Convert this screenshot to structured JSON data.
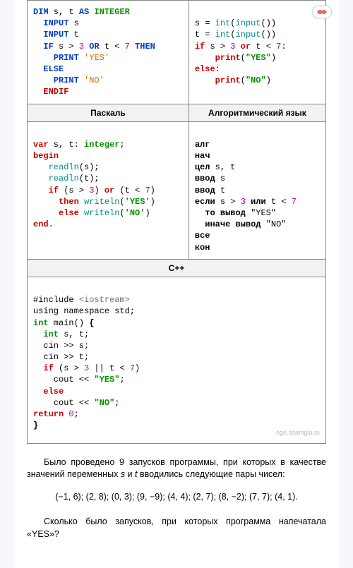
{
  "headers": {
    "pascal": "Паскаль",
    "alg": "Алгоритмический язык",
    "cpp": "С++"
  },
  "code": {
    "basic": {
      "l1a": "DIM",
      "l1b": " s, t ",
      "l1c": "AS",
      "l1d": " INTEGER",
      "l2a": "  INPUT",
      "l2b": " s",
      "l3a": "  INPUT",
      "l3b": " t",
      "l4a": "  IF",
      "l4b": " s > ",
      "l4c": "3",
      "l4d": " OR",
      "l4e": " t < ",
      "l4f": "7",
      "l4g": " THEN",
      "l5a": "    PRINT ",
      "l5b": "'YES'",
      "l6a": "  ELSE",
      "l7a": "    PRINT ",
      "l7b": "'NO'",
      "l8a": "  ENDIF"
    },
    "python": {
      "l1a": "s = ",
      "l1b": "int",
      "l1c": "(",
      "l1d": "input",
      "l1e": "())",
      "l2a": "t = ",
      "l2b": "int",
      "l2c": "(",
      "l2d": "input",
      "l2e": "())",
      "l3a": "if",
      "l3b": " s > ",
      "l3c": "3",
      "l3d": " or",
      "l3e": " t < ",
      "l3f": "7",
      "l3g": ":",
      "l4a": "    print",
      "l4b": "(",
      "l4c": "\"YES\"",
      "l4d": ")",
      "l5a": "else",
      "l5b": ":",
      "l6a": "    print",
      "l6b": "(",
      "l6c": "\"NO\"",
      "l6d": ")"
    },
    "pascal": {
      "l1a": "var",
      "l1b": " s, t: ",
      "l1c": "integer",
      "l1d": ";",
      "l2a": "begin",
      "l3a": "   readln",
      "l3b": "(s);",
      "l4a": "   readln",
      "l4b": "(t);",
      "l5a": "   if",
      "l5b": " (s > ",
      "l5c": "3",
      "l5d": ") ",
      "l5e": "or",
      "l5f": " (t < ",
      "l5g": "7",
      "l5h": ")",
      "l6a": "     then",
      "l6b": " writeln",
      "l6c": "(",
      "l6d": "'YES'",
      "l6e": ")",
      "l7a": "     else",
      "l7b": " writeln",
      "l7c": "(",
      "l7d": "'NO'",
      "l7e": ")",
      "l8a": "end",
      "l8b": "."
    },
    "alg": {
      "l1": "алг",
      "l2": "нач",
      "l3a": "цел",
      "l3b": " s, t",
      "l4a": "ввод",
      "l4b": " s",
      "l5a": "ввод",
      "l5b": " t",
      "l6a": "если",
      "l6b": " s > ",
      "l6c": "3",
      "l6d": " или",
      "l6e": " t < ",
      "l6f": "7",
      "l7a": "  то вывод ",
      "l7b": "\"YES\"",
      "l8a": "  иначе вывод ",
      "l8b": "\"NO\"",
      "l9": "все",
      "l10": "кон"
    },
    "cpp": {
      "l1a": "#include ",
      "l1b": "<iostream>",
      "l2": "using namespace std;",
      "l3a": "int",
      "l3b": " main() ",
      "l3c": "{",
      "l4a": "  int",
      "l4b": " s, t;",
      "l5": "  cin >> s;",
      "l6": "  cin >> t;",
      "l7a": "  if",
      "l7b": " (s > ",
      "l7c": "3",
      "l7d": " || t < ",
      "l7e": "7",
      "l7f": ")",
      "l8a": "    cout << ",
      "l8b": "\"YES\"",
      "l8c": ";",
      "l9a": "  else",
      "l10a": "    cout << ",
      "l10b": "\"NO\"",
      "l10c": ";",
      "l11a": "return ",
      "l11b": "0",
      "l11c": ";",
      "l12": "}"
    }
  },
  "watermark": "oge.sdamgia.ru",
  "text": {
    "p1a": "Было проведено 9 запусков программы, при которых в качестве значений переменных ",
    "p1s": "s",
    "p1b": " и ",
    "p1t": "t",
    "p1c": " вводились следующие пары чисел:",
    "pairs": "(−1, 6); (2, 8); (0, 3); (9, −9); (4, 4); (2, 7); (8, −2); (7, 7); (4, 1).",
    "p2": "Сколько было запусков, при которых программа напечатала «YES»?"
  }
}
